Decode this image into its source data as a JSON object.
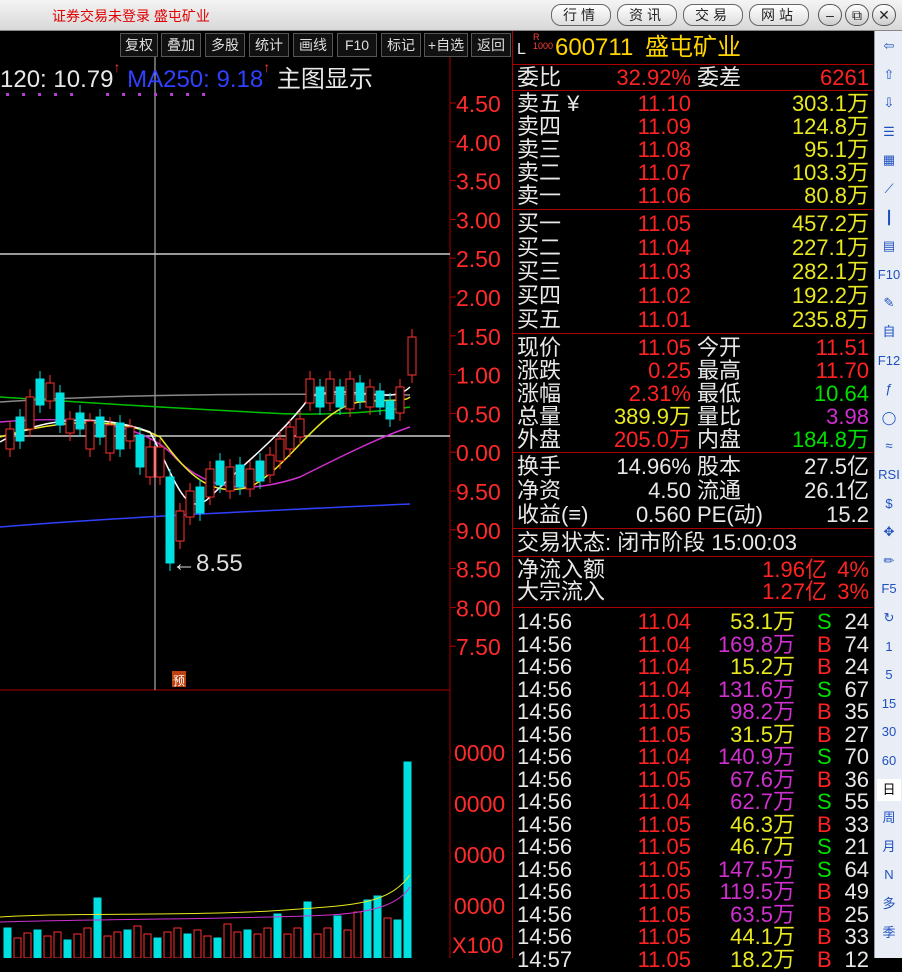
{
  "topbar": {
    "title": "证券交易未登录 盛屯矿业",
    "buttons": [
      "行情",
      "资讯",
      "交易",
      "网站"
    ],
    "window_controls": [
      "minimize-icon",
      "restore-icon",
      "close-icon"
    ]
  },
  "chart_toolbar": [
    "复权",
    "叠加",
    "多股",
    "统计",
    "画线",
    "F10",
    "标记",
    "+自选",
    "返回"
  ],
  "legend": {
    "ma120": "120: 10.79",
    "ma120_arrow": "↑",
    "ma250": "MA250: 9.18",
    "ma250_arrow": "↑",
    "main_display": "主图显示"
  },
  "chart_data": {
    "type": "candlestick",
    "y_ticks": [
      "4.50",
      "4.00",
      "3.50",
      "3.00",
      "2.50",
      "2.00",
      "1.50",
      "1.00",
      "0.50",
      "0.00",
      "9.50",
      "9.00",
      "8.50",
      "8.00",
      "7.50"
    ],
    "min_label": "8.55",
    "marker": "预",
    "volume_ticks": [
      "0000",
      "0000",
      "0000",
      "0000"
    ],
    "volume_unit": "X100",
    "colors": {
      "up": "#ff3030",
      "down": "#00e0e0",
      "ma5": "#ffffff",
      "ma10": "#e8e820",
      "ma20": "#d030d0",
      "ma60": "#00c000",
      "ma250": "#3040ff"
    }
  },
  "stock": {
    "flag": "L",
    "flag_sub": "R\n1000",
    "code": "600711",
    "name": "盛屯矿业",
    "weibi_label": "委比",
    "weibi": "32.92%",
    "weicha_label": "委差",
    "weicha": "6261",
    "asks": [
      {
        "label": "卖五 ¥",
        "price": "11.10",
        "vol": "303.1万"
      },
      {
        "label": "卖四",
        "price": "11.09",
        "vol": "124.8万"
      },
      {
        "label": "卖三",
        "price": "11.08",
        "vol": "95.1万"
      },
      {
        "label": "卖二",
        "price": "11.07",
        "vol": "103.3万"
      },
      {
        "label": "卖一",
        "price": "11.06",
        "vol": "80.8万"
      }
    ],
    "bids": [
      {
        "label": "买一",
        "price": "11.05",
        "vol": "457.2万"
      },
      {
        "label": "买二",
        "price": "11.04",
        "vol": "227.1万"
      },
      {
        "label": "买三",
        "price": "11.03",
        "vol": "282.1万"
      },
      {
        "label": "买四",
        "price": "11.02",
        "vol": "192.2万"
      },
      {
        "label": "买五",
        "price": "11.01",
        "vol": "235.8万"
      }
    ],
    "quote": [
      {
        "l1": "现价",
        "v1": "11.05",
        "l2": "今开",
        "v2": "11.51",
        "c1": "red",
        "c2": "red"
      },
      {
        "l1": "涨跌",
        "v1": "0.25",
        "l2": "最高",
        "v2": "11.70",
        "c1": "red",
        "c2": "red"
      },
      {
        "l1": "涨幅",
        "v1": "2.31%",
        "l2": "最低",
        "v2": "10.64",
        "c1": "red",
        "c2": "green"
      },
      {
        "l1": "总量",
        "v1": "389.9万",
        "l2": "量比",
        "v2": "3.98",
        "c1": "yellow",
        "c2": "magenta"
      },
      {
        "l1": "外盘",
        "v1": "205.0万",
        "l2": "内盘",
        "v2": "184.8万",
        "c1": "red",
        "c2": "green"
      }
    ],
    "fund": [
      {
        "l1": "换手",
        "v1": "14.96%",
        "l2": "股本",
        "v2": "27.5亿"
      },
      {
        "l1": "净资",
        "v1": "4.50",
        "l2": "流通",
        "v2": "26.1亿"
      },
      {
        "l1": "收益(≡)",
        "v1": "0.560",
        "l2": "PE(动)",
        "v2": "15.2"
      }
    ],
    "status": "交易状态: 闭市阶段 15:00:03",
    "flows": [
      {
        "label": "净流入额",
        "value": "1.96亿",
        "pct": "4%"
      },
      {
        "label": "大宗流入",
        "value": "1.27亿",
        "pct": "3%"
      }
    ],
    "ticks": [
      {
        "t": "14:56",
        "p": "11.04",
        "v": "53.1万",
        "s": "S",
        "n": "24",
        "vc": "yellow"
      },
      {
        "t": "14:56",
        "p": "11.04",
        "v": "169.8万",
        "s": "B",
        "n": "74",
        "vc": "magenta"
      },
      {
        "t": "14:56",
        "p": "11.04",
        "v": "15.2万",
        "s": "B",
        "n": "24",
        "vc": "yellow"
      },
      {
        "t": "14:56",
        "p": "11.04",
        "v": "131.6万",
        "s": "S",
        "n": "67",
        "vc": "magenta"
      },
      {
        "t": "14:56",
        "p": "11.05",
        "v": "98.2万",
        "s": "B",
        "n": "35",
        "vc": "magenta"
      },
      {
        "t": "14:56",
        "p": "11.05",
        "v": "31.5万",
        "s": "B",
        "n": "27",
        "vc": "yellow"
      },
      {
        "t": "14:56",
        "p": "11.04",
        "v": "140.9万",
        "s": "S",
        "n": "70",
        "vc": "magenta"
      },
      {
        "t": "14:56",
        "p": "11.05",
        "v": "67.6万",
        "s": "B",
        "n": "36",
        "vc": "magenta"
      },
      {
        "t": "14:56",
        "p": "11.04",
        "v": "62.7万",
        "s": "S",
        "n": "55",
        "vc": "magenta"
      },
      {
        "t": "14:56",
        "p": "11.05",
        "v": "46.3万",
        "s": "B",
        "n": "33",
        "vc": "yellow"
      },
      {
        "t": "14:56",
        "p": "11.05",
        "v": "46.7万",
        "s": "S",
        "n": "21",
        "vc": "yellow"
      },
      {
        "t": "14:56",
        "p": "11.05",
        "v": "147.5万",
        "s": "S",
        "n": "64",
        "vc": "magenta"
      },
      {
        "t": "14:56",
        "p": "11.05",
        "v": "119.5万",
        "s": "B",
        "n": "49",
        "vc": "magenta"
      },
      {
        "t": "14:56",
        "p": "11.05",
        "v": "63.5万",
        "s": "B",
        "n": "25",
        "vc": "magenta"
      },
      {
        "t": "14:56",
        "p": "11.05",
        "v": "44.1万",
        "s": "B",
        "n": "33",
        "vc": "yellow"
      },
      {
        "t": "14:57",
        "p": "11.05",
        "v": "18.2万",
        "s": "B",
        "n": "12",
        "vc": "yellow"
      }
    ]
  },
  "tools": [
    "back-icon",
    "up-icon",
    "down-icon",
    "list-icon",
    "grid-icon",
    "line-icon",
    "candle-icon",
    "doc-icon",
    "F10",
    "note-icon",
    "自",
    "F12",
    "fx-icon",
    "circle-icon",
    "wave-icon",
    "RSI",
    "dollar-icon",
    "move-icon",
    "pencil-icon",
    "F5",
    "refresh-icon",
    "1",
    "5",
    "15",
    "30",
    "60",
    "日",
    "周",
    "月",
    "N",
    "多",
    "季"
  ]
}
